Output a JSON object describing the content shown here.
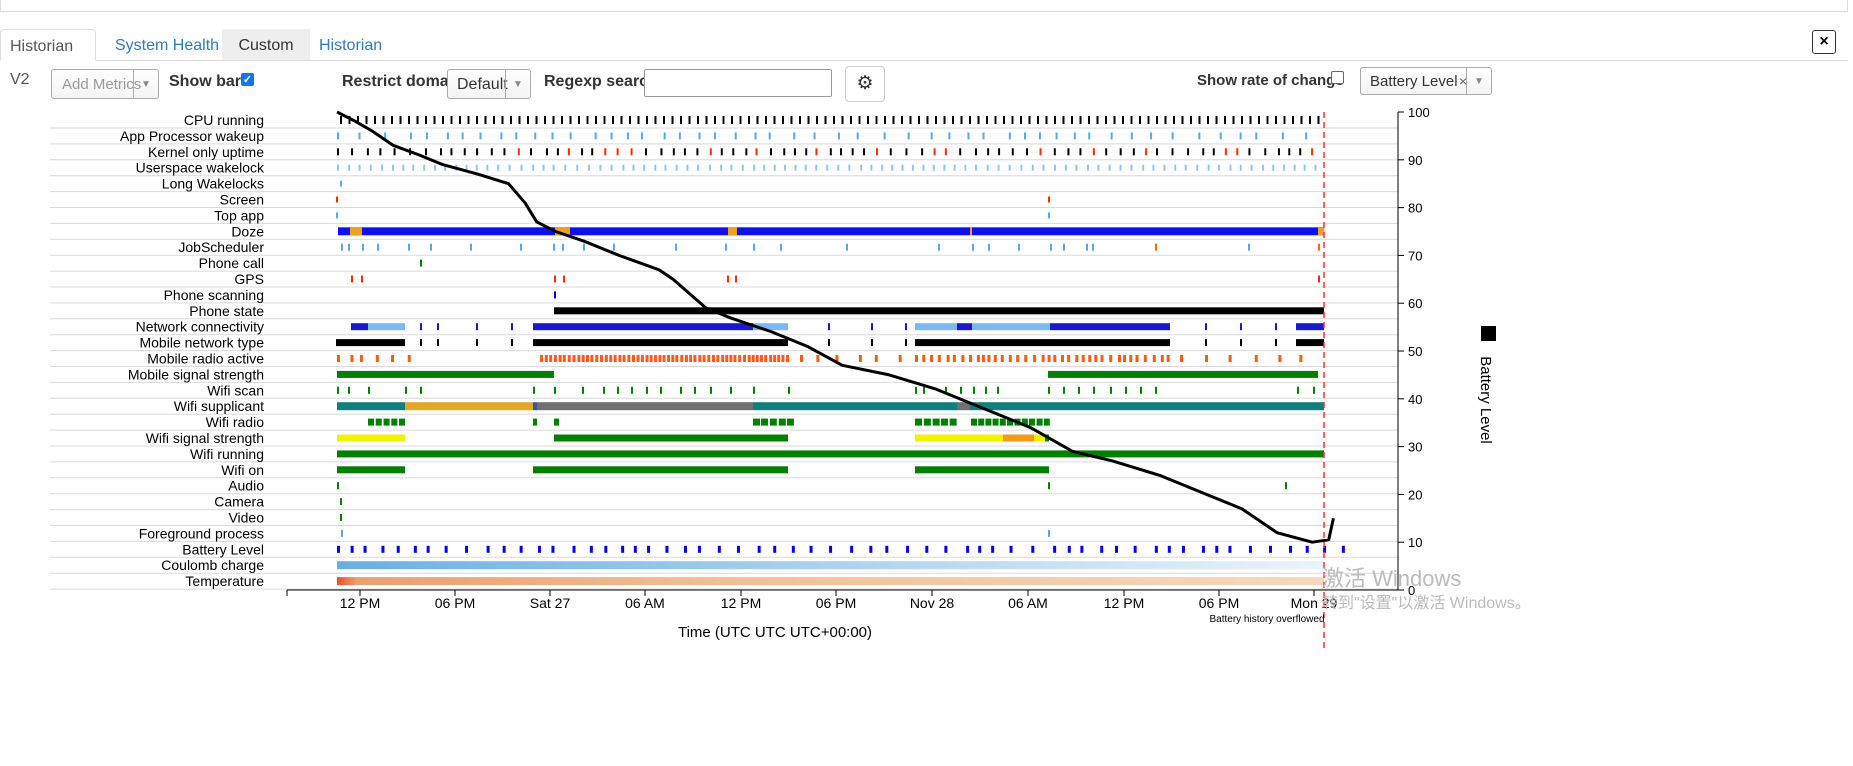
{
  "tabs": [
    {
      "label": "Historian V2",
      "active": true
    },
    {
      "label": "System Health",
      "active": false
    },
    {
      "label": "Custom",
      "active": false
    },
    {
      "label": "Historian",
      "active": false
    }
  ],
  "close_icon": "×",
  "toolbar": {
    "add_metrics_placeholder": "Add Metrics",
    "show_bars_label": "Show bars",
    "show_bars_checked": true,
    "restrict_domain_label": "Restrict domain",
    "domain_value": "Default",
    "regexp_label": "Regexp search",
    "regexp_value": "",
    "settings_icon": "gear-icon",
    "rate_of_change_label": "Show rate of change",
    "rate_of_change_checked": false,
    "metric_tag": "Battery Level",
    "metric_tag_remove": "×"
  },
  "chart_data": {
    "type": "timeline",
    "xlabel": "Time (UTC UTC UTC+00:00)",
    "x_ticks": [
      "12 PM",
      "06 PM",
      "Sat 27",
      "06 AM",
      "12 PM",
      "06 PM",
      "Nov 28",
      "06 AM",
      "12 PM",
      "06 PM",
      "Mon 29"
    ],
    "y2_ticks": [
      100,
      90,
      80,
      70,
      60,
      50,
      40,
      30,
      20,
      10,
      0
    ],
    "y2label": "Battery Level",
    "y2lim": [
      0,
      100
    ],
    "overflow_note": "Battery history overflowed",
    "rows": [
      "CPU running",
      "App Processor wakeup",
      "Kernel only uptime",
      "Userspace wakelock",
      "Long Wakelocks",
      "Screen",
      "Top app",
      "Doze",
      "JobScheduler",
      "Phone call",
      "GPS",
      "Phone scanning",
      "Phone state",
      "Network connectivity",
      "Mobile network type",
      "Mobile radio active",
      "Mobile signal strength",
      "Wifi scan",
      "Wifi supplicant",
      "Wifi radio",
      "Wifi signal strength",
      "Wifi running",
      "Wifi on",
      "Audio",
      "Camera",
      "Video",
      "Foreground process",
      "Battery Level",
      "Coulomb charge",
      "Temperature"
    ],
    "battery_series": {
      "name": "Battery Level",
      "x_hours": [
        0,
        0.8,
        1.5,
        2.4,
        3.5,
        4.5,
        6,
        7.3,
        8,
        8.5,
        9.3,
        10.5,
        12,
        13.7,
        14.3,
        15,
        15.7,
        16.7,
        18.5,
        20,
        21.5,
        23.5,
        25.5,
        27.5,
        28.5,
        29.5,
        31.3,
        33,
        35,
        36.5,
        38.5,
        40,
        41.5,
        42.2,
        42.4
      ],
      "y": [
        100,
        98,
        96,
        93,
        91,
        89,
        87,
        85,
        81,
        77,
        75,
        73,
        70,
        67,
        65,
        62,
        59,
        57,
        54,
        51,
        47,
        45,
        42,
        38,
        36,
        34,
        29,
        27,
        24,
        21,
        17,
        12,
        10,
        10.5,
        15
      ]
    }
  },
  "watermark": {
    "line1": "激活 Windows",
    "line2": "转到\"设置\"以激活 Windows。"
  }
}
